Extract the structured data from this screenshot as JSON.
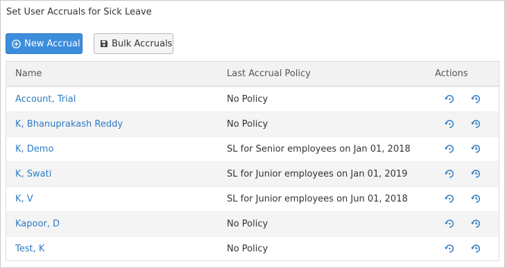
{
  "page": {
    "title": "Set User Accruals for Sick Leave"
  },
  "toolbar": {
    "new_accrual_label": "New Accrual",
    "bulk_accruals_label": "Bulk Accruals"
  },
  "table": {
    "columns": [
      "Name",
      "Last Accrual Policy",
      "Actions"
    ],
    "rows": [
      {
        "name": "Account, Trial",
        "policy": "No Policy"
      },
      {
        "name": "K, Bhanuprakash Reddy",
        "policy": "No Policy"
      },
      {
        "name": "K, Demo",
        "policy": "SL for Senior employees on Jan 01, 2018"
      },
      {
        "name": "K, Swati",
        "policy": "SL for Junior employees on Jan 01, 2019"
      },
      {
        "name": "K, V",
        "policy": "SL for Junior employees on Jun 01, 2018"
      },
      {
        "name": "Kapoor, D",
        "policy": "No Policy"
      },
      {
        "name": "Test, K",
        "policy": "No Policy"
      }
    ]
  },
  "colors": {
    "primary": "#3c8ddc",
    "link": "#2e7bc4",
    "row_alt": "#f4f4f4",
    "header_bg": "#f2f2f2"
  },
  "icons": {
    "new_accrual": "plus-circle-icon",
    "bulk_accruals": "floppy-disk-icon",
    "action_1": "undo-history-icon",
    "action_2": "history-clock-icon"
  }
}
